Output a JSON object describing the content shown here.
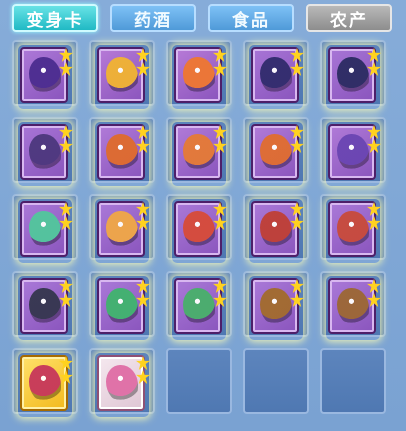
{
  "tabs": [
    {
      "label": "变身卡",
      "state": "active"
    },
    {
      "label": "药酒",
      "state": "normal"
    },
    {
      "label": "食品",
      "state": "normal"
    },
    {
      "label": "农产",
      "state": "farm"
    }
  ],
  "inventory": {
    "items": [
      {
        "icon": "dragon-card-icon",
        "stars": 2,
        "card_color": "#ad79d8",
        "creature_color": "#4b2c8f"
      },
      {
        "icon": "lion-dance-card-icon",
        "stars": 2,
        "card_color": "#b77ad7",
        "creature_color": "#f1b331"
      },
      {
        "icon": "lion-dance-card-icon",
        "stars": 2,
        "card_color": "#b77ad7",
        "creature_color": "#ef7730"
      },
      {
        "icon": "dark-knight-card-icon",
        "stars": 2,
        "card_color": "#a875d6",
        "creature_color": "#302b6c"
      },
      {
        "icon": "armored-horse-card-icon",
        "stars": 2,
        "card_color": "#a875d6",
        "creature_color": "#2b2b62"
      },
      {
        "icon": "purple-knight-card-icon",
        "stars": 2,
        "card_color": "#a875d6",
        "creature_color": "#4c377d"
      },
      {
        "icon": "fire-spirit-card-icon",
        "stars": 2,
        "card_color": "#b17bd8",
        "creature_color": "#df6b2c"
      },
      {
        "icon": "fire-spirit-card-icon",
        "stars": 2,
        "card_color": "#b17bd8",
        "creature_color": "#e57a35"
      },
      {
        "icon": "fire-spirit-card-icon",
        "stars": 2,
        "card_color": "#b17bd8",
        "creature_color": "#e06d2f"
      },
      {
        "icon": "purple-warrior-card-icon",
        "stars": 2,
        "card_color": "#b17bd8",
        "creature_color": "#6a45b2"
      },
      {
        "icon": "green-fairy-card-icon",
        "stars": 2,
        "card_color": "#aa79d8",
        "creature_color": "#51c79c"
      },
      {
        "icon": "fox-spirit-card-icon",
        "stars": 2,
        "card_color": "#aa79d8",
        "creature_color": "#f0a745"
      },
      {
        "icon": "phoenix-card-icon",
        "stars": 2,
        "card_color": "#aa79d8",
        "creature_color": "#d74b38"
      },
      {
        "icon": "red-warrior-card-icon",
        "stars": 2,
        "card_color": "#aa79d8",
        "creature_color": "#bf3f35"
      },
      {
        "icon": "red-warrior-card-icon",
        "stars": 2,
        "card_color": "#aa79d8",
        "creature_color": "#c84a3a"
      },
      {
        "icon": "blue-maiden-card-icon",
        "stars": 2,
        "card_color": "#aa79d8",
        "creature_color": "#34364e"
      },
      {
        "icon": "green-dragon-card-icon",
        "stars": 2,
        "card_color": "#aa79d8",
        "creature_color": "#3fb46d"
      },
      {
        "icon": "green-dragon-card-icon",
        "stars": 2,
        "card_color": "#aa79d8",
        "creature_color": "#48b06a"
      },
      {
        "icon": "golden-general-card-icon",
        "stars": 2,
        "card_color": "#aa79d8",
        "creature_color": "#a26b2c"
      },
      {
        "icon": "golden-general-card-icon",
        "stars": 2,
        "card_color": "#aa79d8",
        "creature_color": "#9c6733"
      },
      {
        "icon": "red-haired-girl-card-icon",
        "stars": 2,
        "card_color": "#f7cf4e",
        "creature_color": "#c6365b",
        "variant": "gold"
      },
      {
        "icon": "pink-dancer-card-icon",
        "stars": 2,
        "card_color": "#ead6e0",
        "creature_color": "#df6da5",
        "variant": "pink"
      },
      {
        "icon": "",
        "stars": 0,
        "empty": true
      },
      {
        "icon": "",
        "stars": 0,
        "empty": true
      },
      {
        "icon": "",
        "stars": 0,
        "empty": true
      }
    ]
  },
  "colors": {
    "background": "#7fa8d8",
    "active_tab": "#20b9c4",
    "slot": "#557db6",
    "star": "#ffd21f"
  }
}
